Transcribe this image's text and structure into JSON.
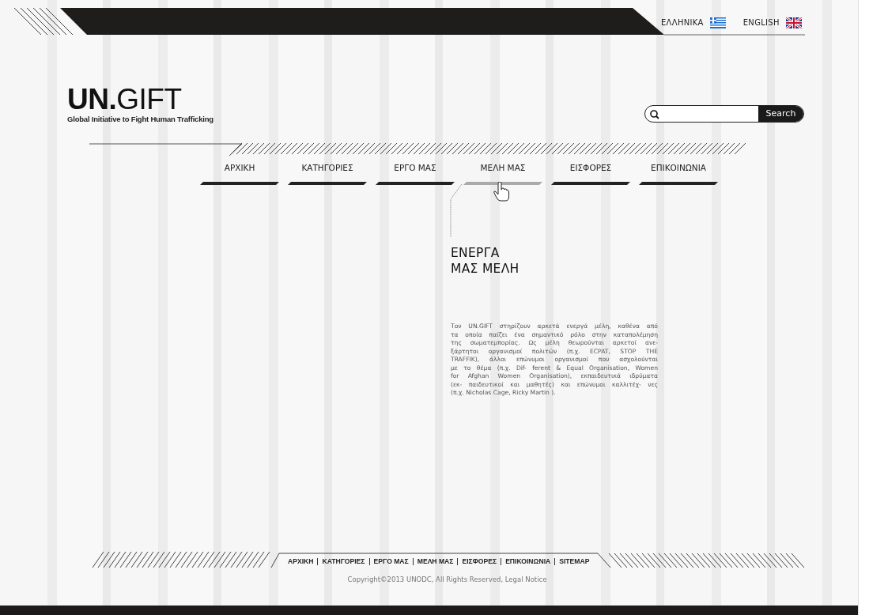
{
  "languages": [
    {
      "label": "ΕΛΛΗΝΙΚΑ",
      "kind": "greek"
    },
    {
      "label": "ENGLISH",
      "kind": "uk"
    }
  ],
  "logo": {
    "title": "**UN.**GIFT",
    "subtitle": "Global Initiative to Fight Human Trafficking"
  },
  "search": {
    "button": "Search"
  },
  "nav": [
    {
      "label": "ΑΡΧΙΚΗ",
      "selected": false
    },
    {
      "label": "ΚΑΤΗΓΟΡΙΕΣ",
      "selected": false
    },
    {
      "label": "ΕΡΓΟ ΜΑΣ",
      "selected": false
    },
    {
      "label": "ΜΕΛΗ ΜΑΣ",
      "selected": true
    },
    {
      "label": "ΕΙΣΦΟΡΕΣ",
      "selected": false
    },
    {
      "label": "ΕΠΙΚΟΙΝΩΝΙΑ",
      "selected": false
    }
  ],
  "article": {
    "heading_lines": [
      "ΕΝΕΡΓΑ",
      "ΜΑΣ ΜΕΛΗ"
    ],
    "lines": [
      "Τον UN.GIFT στηρίζουν αρκετά ενεργά μέλη, καθένα από",
      "τα οποία παίζει ένα σημαντικό ρόλο στην καταπολέμηση",
      "της σωματεμπορίας. Ως μέλη θεωρούνται αρκετοί ανε-",
      "ξάρτητοι οργανισμοί πολιτών (π.χ. ECPAT, STOP THE",
      "TRAFFIK), άλλοι επώνυμοι οργανισμοί που ασχολούνται",
      "με το θέμα (π.χ. Dif- ferent & Equal Organisation, Women",
      "for Afghan Women Organisation), εκπαιδευτικά ιδρύματα",
      "(εκ- παιδευτικοί και μαθητές) και επώνυμοι καλλιτέχ- νες",
      "(π.χ. Nicholas Cage, Ricky Martin )."
    ]
  },
  "footer": {
    "links": [
      "ΑΡΧΙΚΗ",
      "ΚΑΤΗΓΟΡΙΕΣ",
      "ΕΡΓΟ ΜΑΣ",
      "ΜΕΛΗ ΜΑΣ",
      "ΕΙΣΦΟΡΕΣ",
      "ΕΠΙΚΟΙΝΩΝΙΑ",
      "SITEMAP"
    ],
    "copyright": "Copyright©2013 UNODC, All Rights Reserved, Legal Notice"
  }
}
